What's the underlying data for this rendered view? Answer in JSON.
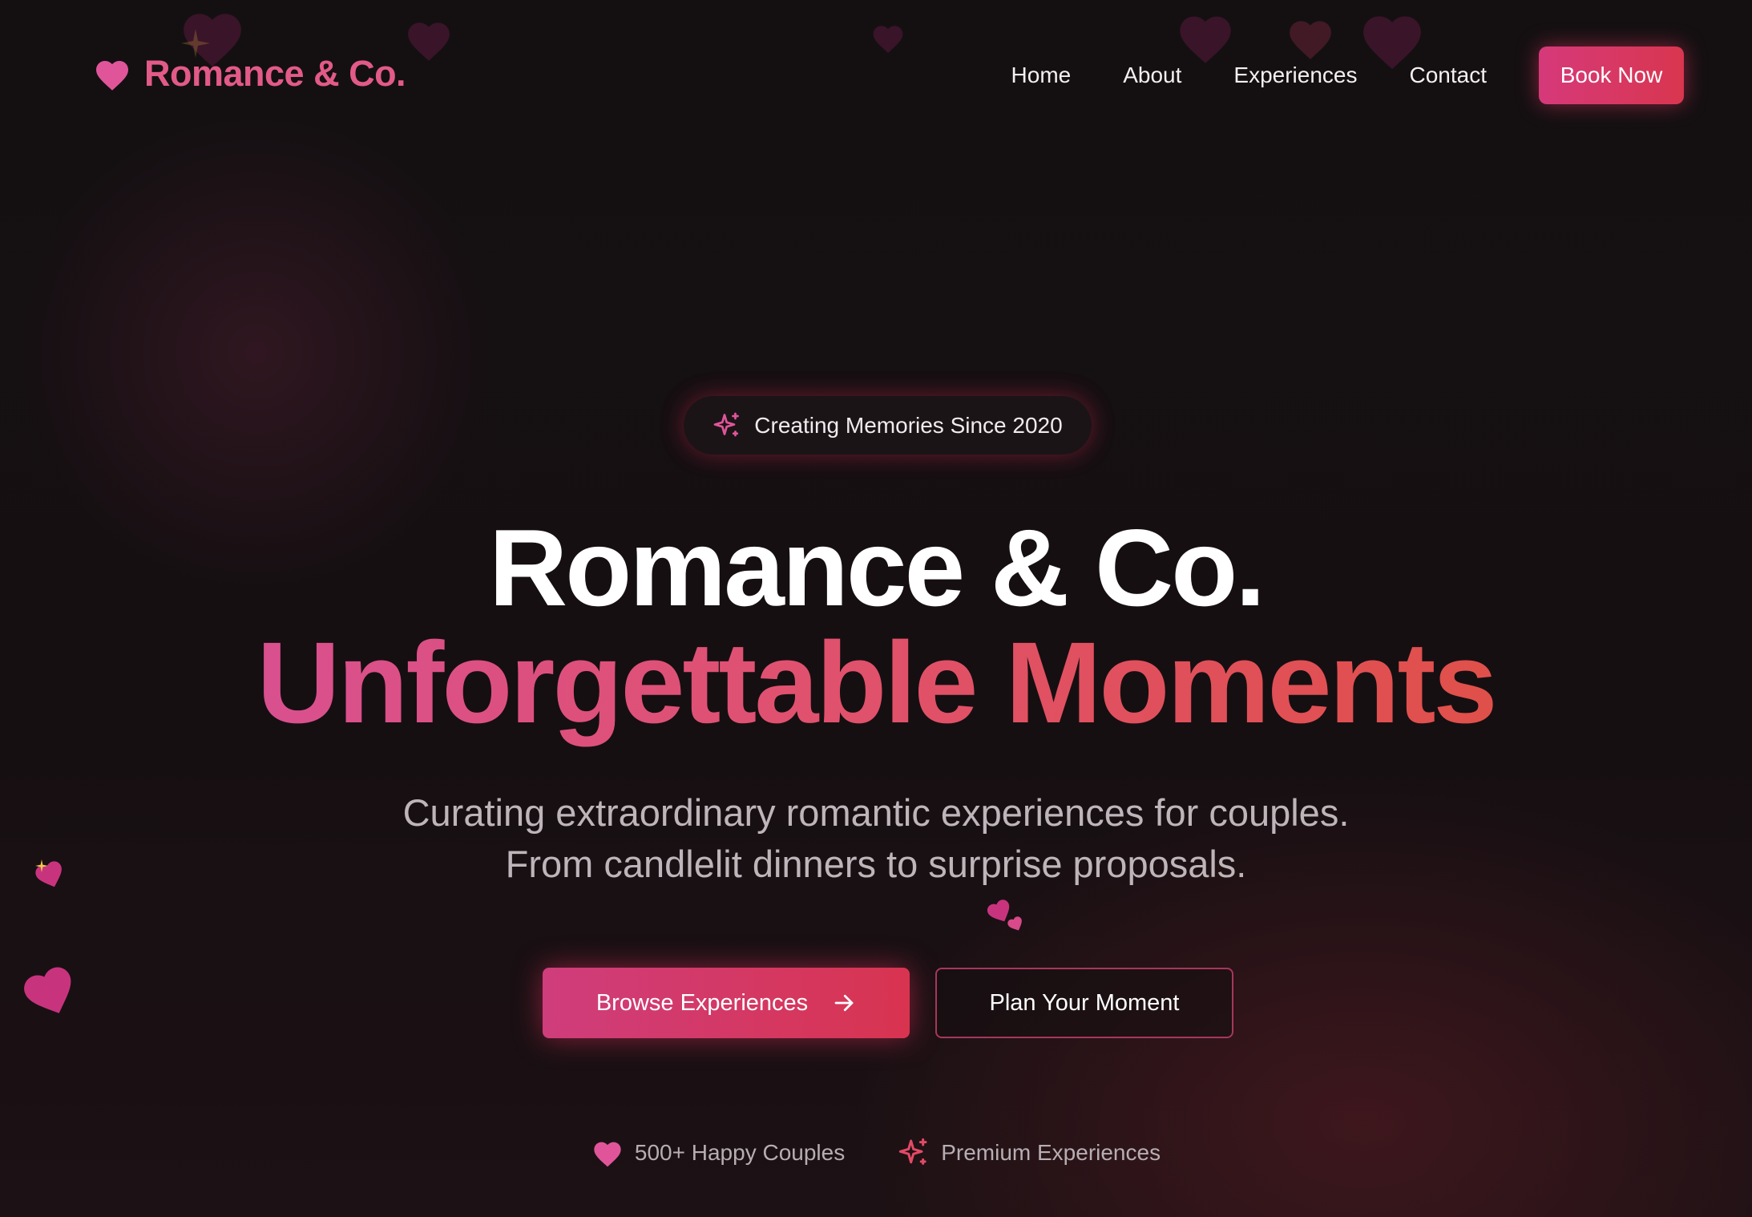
{
  "brand": {
    "name": "Romance & Co.",
    "icon": "heart-icon",
    "color": "#e25a88"
  },
  "nav": {
    "items": [
      {
        "label": "Home"
      },
      {
        "label": "About"
      },
      {
        "label": "Experiences"
      },
      {
        "label": "Contact"
      }
    ],
    "cta_label": "Book Now"
  },
  "hero": {
    "badge": {
      "icon": "sparkles-icon",
      "text": "Creating Memories Since 2020"
    },
    "title_line1": "Romance & Co.",
    "title_line2": "Unforgettable Moments",
    "subtitle": "Curating extraordinary romantic experiences for couples. From candlelit dinners to surprise proposals.",
    "primary_button": {
      "label": "Browse Experiences",
      "icon": "arrow-right-icon"
    },
    "secondary_button": {
      "label": "Plan Your Moment"
    },
    "stats": [
      {
        "icon": "heart-icon",
        "text": "500+ Happy Couples"
      },
      {
        "icon": "sparkles-icon",
        "text": "Premium Experiences"
      }
    ]
  },
  "colors": {
    "background": "#141012",
    "accent_pink": "#d6397a",
    "accent_red": "#d9364f",
    "muted_text": "#b6aeb2"
  }
}
